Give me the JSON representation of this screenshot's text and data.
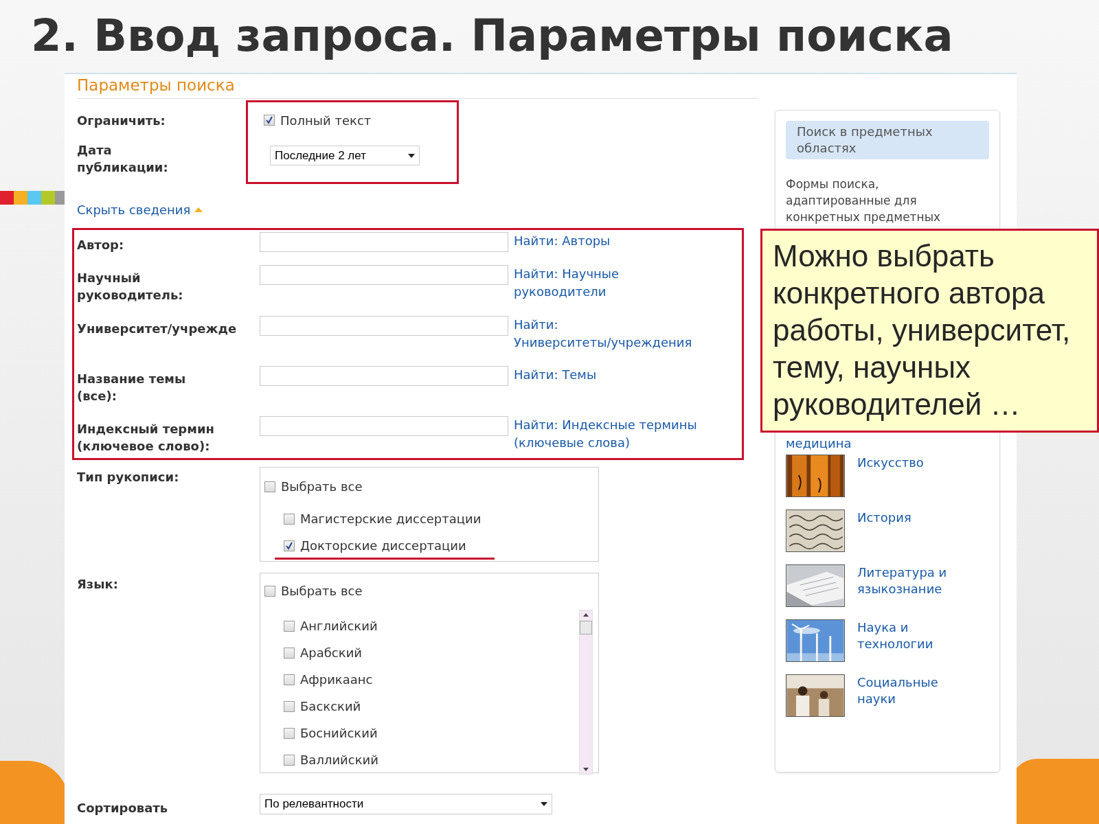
{
  "slide": {
    "title": "2. Ввод запроса. Параметры поиска"
  },
  "form": {
    "heading": "Параметры поиска",
    "limit": {
      "label": "Ограничить:",
      "option": {
        "label": "Полный текст",
        "checked": true
      }
    },
    "pub_date": {
      "label": "Дата\nпубликации:",
      "value": "Последние 2 лет"
    },
    "toggle_link": "Скрыть сведения",
    "fields": [
      {
        "label": "Автор:",
        "link": "Найти: Авторы"
      },
      {
        "label": "Научный\nруководитель:",
        "link": "Найти: Научные\nруководители"
      },
      {
        "label": "Университет/учрежде",
        "link": "Найти:\nУниверситеты/учреждения"
      },
      {
        "label": "Название темы\n(все):",
        "link": "Найти: Темы"
      },
      {
        "label": "Индексный термин\n(ключевое слово):",
        "link": "Найти: Индексные термины\n(ключевые слова)"
      }
    ],
    "manuscript_type": {
      "label": "Тип рукописи:",
      "select_all": {
        "label": "Выбрать все",
        "checked": false
      },
      "options": [
        {
          "label": "Магистерские диссертации",
          "checked": false
        },
        {
          "label": "Докторские диссертации",
          "checked": true
        }
      ]
    },
    "language": {
      "label": "Язык:",
      "select_all": {
        "label": "Выбрать все",
        "checked": false
      },
      "options": [
        {
          "label": "Английский",
          "checked": false
        },
        {
          "label": "Арабский",
          "checked": false
        },
        {
          "label": "Африкаанс",
          "checked": false
        },
        {
          "label": "Баскский",
          "checked": false
        },
        {
          "label": "Боснийский",
          "checked": false
        },
        {
          "label": "Валлийский",
          "checked": false
        }
      ]
    },
    "sort": {
      "label": "Сортировать",
      "value": "По релевантности"
    }
  },
  "sidebar": {
    "heading": "Поиск в предметных\nобластях",
    "description": "Формы поиска,\nадаптированные для\nконкретных предметных",
    "items": [
      {
        "label": "медицина",
        "kind": "text"
      },
      {
        "label": "Искусство",
        "kind": "picture"
      },
      {
        "label": "История",
        "kind": "picture"
      },
      {
        "label": "Литература и\nязыкознание",
        "kind": "picture"
      },
      {
        "label": "Наука и\nтехнологии",
        "kind": "picture"
      },
      {
        "label": "Социальные\nнауки",
        "kind": "picture"
      }
    ]
  },
  "callout": {
    "text": "Можно выбрать\nконкретного автора\nработы, университет,\nтему, научных\nруководителей …"
  }
}
